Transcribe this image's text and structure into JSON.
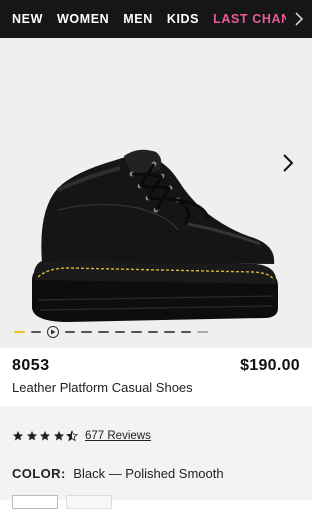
{
  "nav": {
    "items": [
      {
        "label": "NEW"
      },
      {
        "label": "WOMEN"
      },
      {
        "label": "MEN"
      },
      {
        "label": "KIDS"
      },
      {
        "label": "LAST CHAN"
      }
    ],
    "highlight_color": "#e85a9b"
  },
  "gallery": {
    "image_alt": "Black leather platform lace-up shoe",
    "active_dot_color": "#e8c32a",
    "dots_before_play": 2,
    "dots_after_play": 9
  },
  "product": {
    "model": "8053",
    "price": "$190.00",
    "name": "Leather Platform Casual Shoes",
    "rating": 4.5,
    "rating_max": 5,
    "reviews_label": "677 Reviews",
    "color_label": "COLOR:",
    "color_value": "Black — Polished Smooth"
  }
}
